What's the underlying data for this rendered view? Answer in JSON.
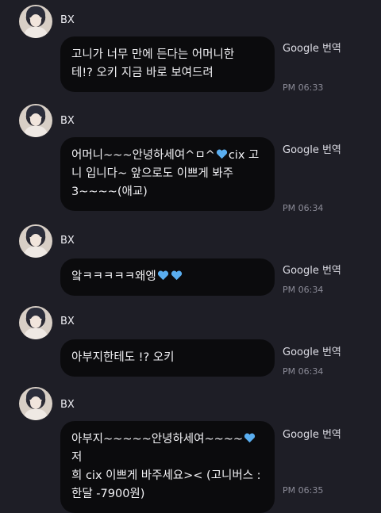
{
  "messages": [
    {
      "sender": "BX",
      "text_parts": [
        "고니가 너무 만에 든다는 어머니한\n테!? 오키 지금 바로 보여드려"
      ],
      "translate": "Google 번역",
      "time": "PM 06:33"
    },
    {
      "sender": "BX",
      "text_parts": [
        "어머니~~~안녕하세여^ㅁ^",
        "cix 고\n니 입니다~ 앞으로도 이쁘게 봐주\n3~~~~(애교)"
      ],
      "translate": "Google 번역",
      "time": "PM 06:34"
    },
    {
      "sender": "BX",
      "text_parts": [
        "앜ㅋㅋㅋㅋㅋ왜엥",
        "",
        ""
      ],
      "translate": "Google 번역",
      "time": "PM 06:34"
    },
    {
      "sender": "BX",
      "text_parts": [
        "아부지한테도 !? 오키"
      ],
      "translate": "Google 번역",
      "time": "PM 06:34"
    },
    {
      "sender": "BX",
      "text_parts": [
        "아부지~~~~~안녕하세여~~~~",
        "저\n희 cix 이쁘게 바주세요>< (고니버스 :\n한달 -7900원)"
      ],
      "translate": "Google 번역",
      "time": "PM 06:35"
    }
  ],
  "colors": {
    "heart": "#5aaef0",
    "bubble": "#0b0b0d",
    "background": "#1e1e26"
  }
}
